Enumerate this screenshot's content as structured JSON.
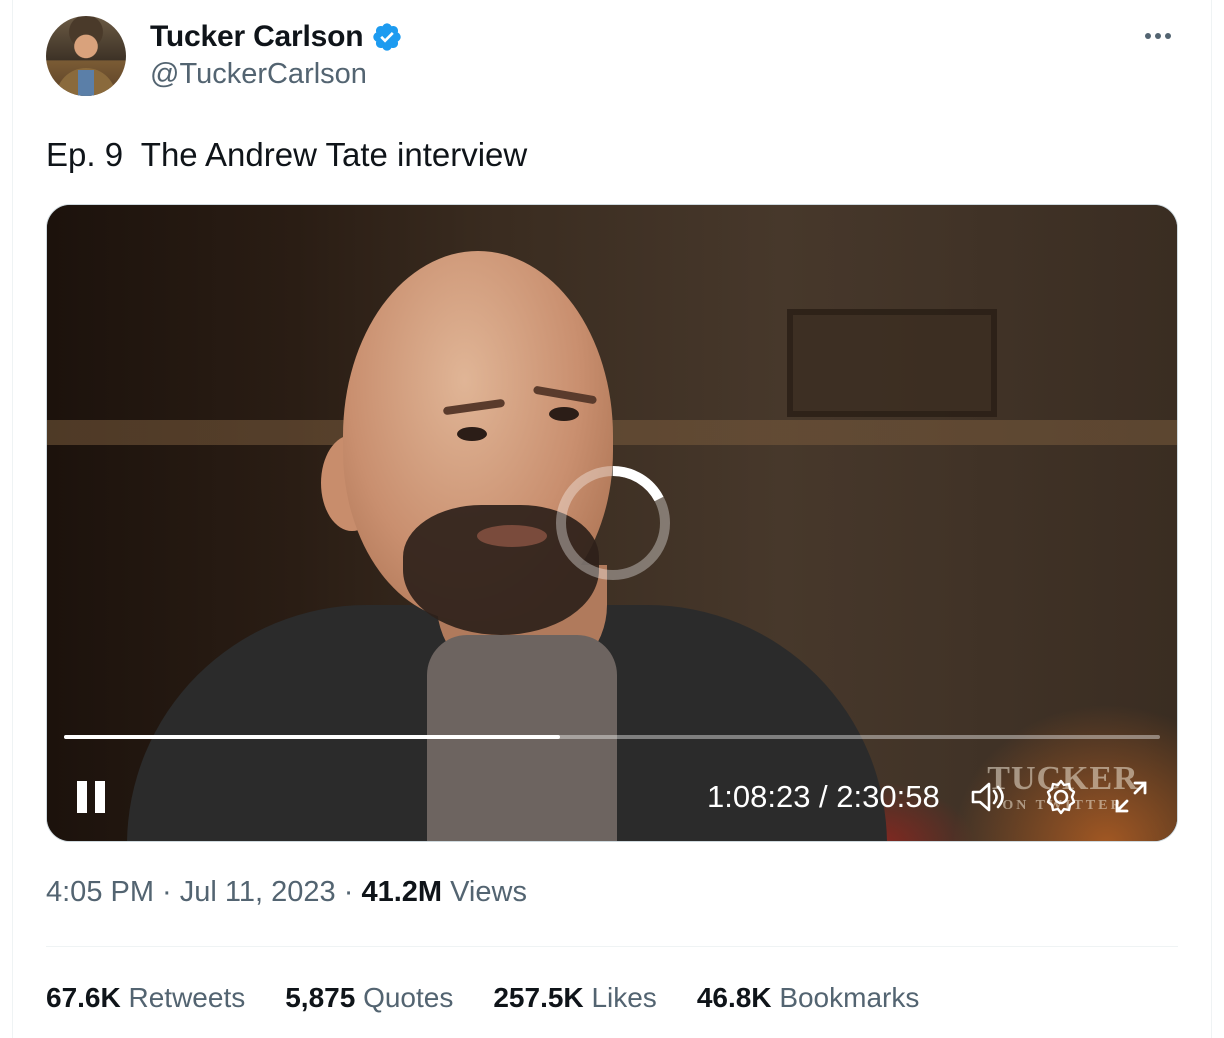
{
  "author": {
    "name": "Tucker Carlson",
    "handle": "@TuckerCarlson",
    "verified": true
  },
  "tweet": {
    "text": "Ep. 9  The Andrew Tate interview"
  },
  "video": {
    "current_time": "1:08:23",
    "duration": "2:30:58",
    "time_display": "1:08:23 / 2:30:58",
    "progress_fraction": 0.4529,
    "loading": true,
    "watermark_big": "TUCKER",
    "watermark_small": "ON TWITTER",
    "controls": [
      "pause-icon",
      "volume-icon",
      "settings-gear-icon",
      "fullscreen-expand-icon"
    ]
  },
  "meta": {
    "time": "4:05 PM",
    "date": "Jul 11, 2023",
    "views_count": "41.2M",
    "views_label": "Views"
  },
  "stats": [
    {
      "count": "67.6K",
      "label": "Retweets"
    },
    {
      "count": "5,875",
      "label": "Quotes"
    },
    {
      "count": "257.5K",
      "label": "Likes"
    },
    {
      "count": "46.8K",
      "label": "Bookmarks"
    }
  ],
  "colors": {
    "text_primary": "#0f1419",
    "text_secondary": "#536471",
    "verified_blue": "#1d9bf0",
    "border": "#eff3f4"
  }
}
